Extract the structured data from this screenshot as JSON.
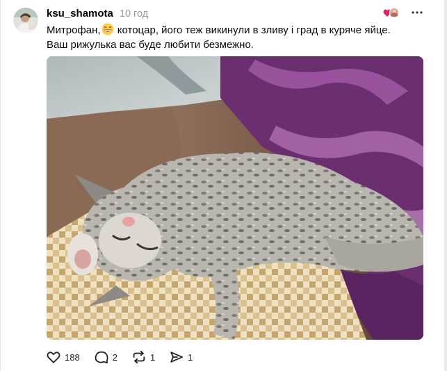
{
  "post": {
    "author": "ksu_shamota",
    "time": "10 год",
    "text_line1_before_emoji": "Митрофан,",
    "emoji": "grinning-face-emoji",
    "text_line1_after_emoji": "котоцар, його теж викинули в зливу і град в куряче яйце.",
    "text_line2": "Ваш рижулька вас буде любити безмежно.",
    "image_description_icon": "sleeping-kitten-photo"
  },
  "actions": {
    "likes": "188",
    "replies": "2",
    "reposts": "1",
    "shares": "1"
  },
  "colors": {
    "username": "#000000",
    "time": "#999999",
    "text": "#0a0a0a",
    "icon": "#1c1c1c",
    "like_accent": "#e0245e"
  }
}
